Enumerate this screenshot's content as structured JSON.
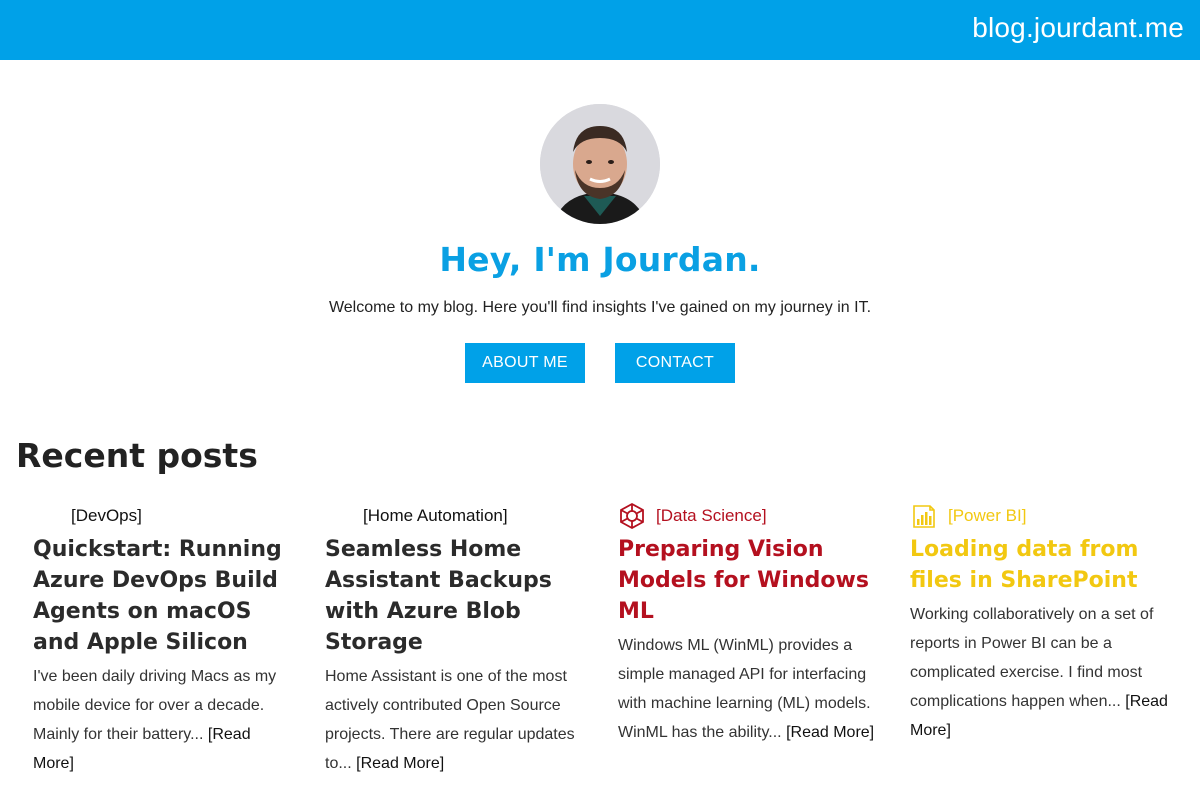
{
  "header": {
    "site_title": "blog.jourdant.me",
    "bar_color": "#00a1e8"
  },
  "hero": {
    "avatar_alt": "avatar",
    "heading": "Hey, I'm Jourdan.",
    "subtitle": "Welcome to my blog. Here you'll find insights I've gained on my journey in IT.",
    "buttons": [
      {
        "label": "ABOUT ME"
      },
      {
        "label": "CONTACT"
      }
    ]
  },
  "recent": {
    "title": "Recent posts",
    "posts": [
      {
        "category": "[DevOps]",
        "icon": "none",
        "color": "#222222",
        "title": "Quickstart: Running Azure DevOps Build Agents on macOS and Apple Silicon",
        "excerpt": "I've been daily driving Macs as my mobile device for over a decade. Mainly for their battery...",
        "read_more": "[Read More]"
      },
      {
        "category": "[Home Automation]",
        "icon": "none",
        "color": "#222222",
        "title": "Seamless Home Assistant Backups with Azure Blob Storage",
        "excerpt": "Home Assistant is one of the most actively contributed Open Source projects. There are regular updates to...",
        "read_more": "[Read More]"
      },
      {
        "category": "[Data Science]",
        "icon": "network-icon",
        "color": "#b4101f",
        "title": "Preparing Vision Models for Windows ML",
        "excerpt": "Windows ML (WinML) provides a simple managed API for interfacing with machine learning (ML) models. WinML has the ability...",
        "read_more": "[Read More]"
      },
      {
        "category": "[Power BI]",
        "icon": "power-bi-icon",
        "color": "#f2c811",
        "title": "Loading data from files in SharePoint",
        "excerpt": "Working collaboratively on a set of reports in Power BI can be a complicated exercise. I find most complications happen when...",
        "read_more": "[Read More]"
      }
    ]
  }
}
